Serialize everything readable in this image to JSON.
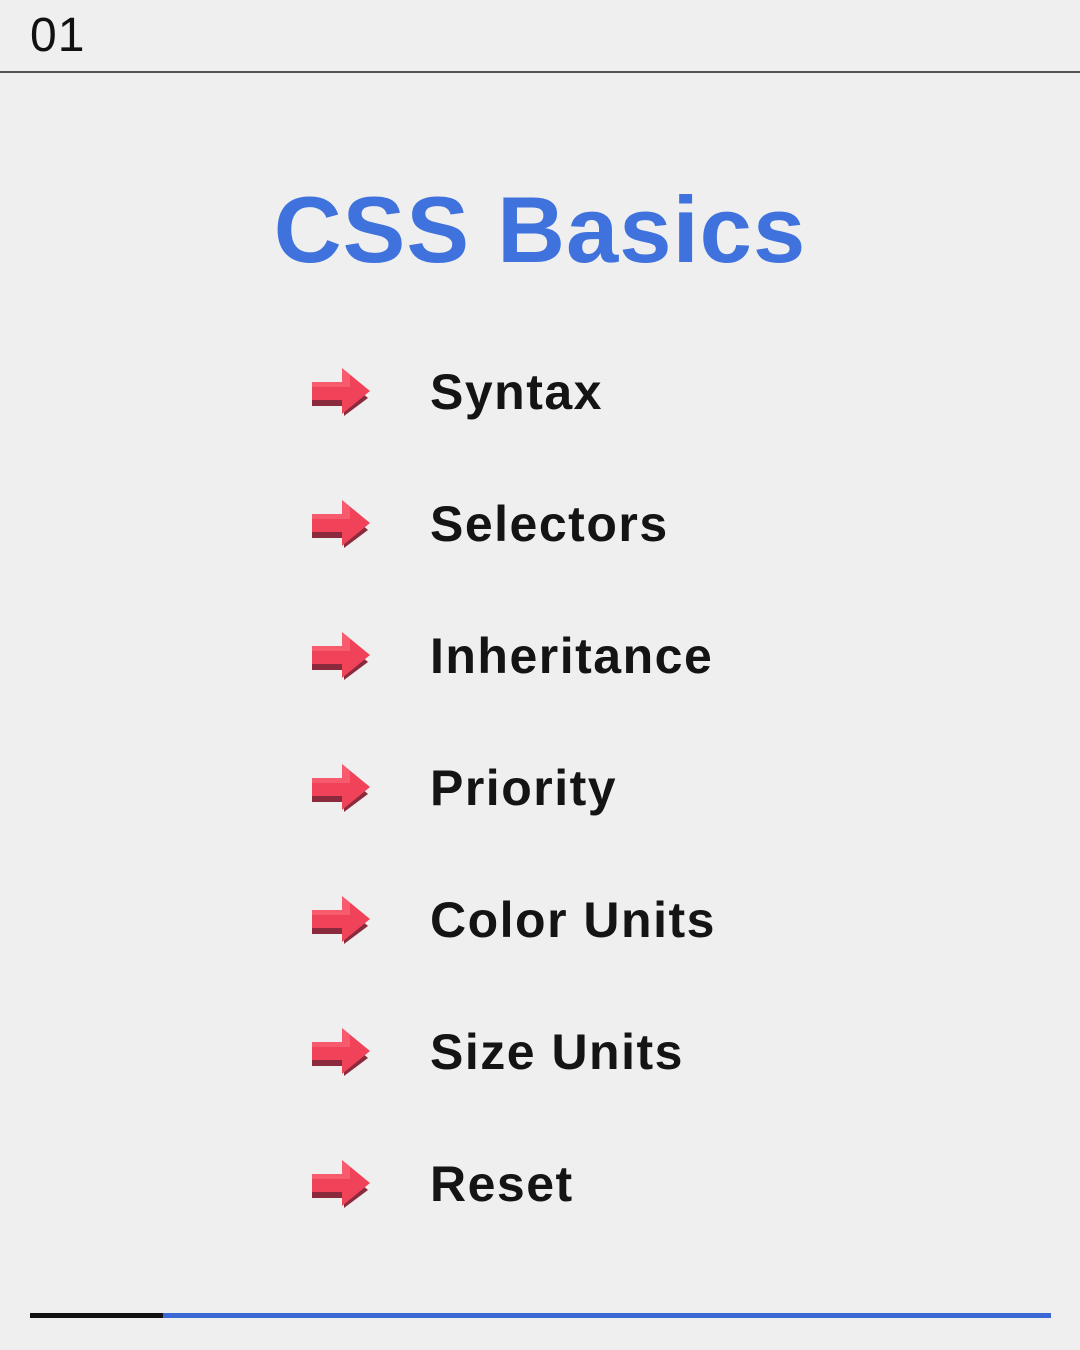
{
  "page_number": "01",
  "title": "CSS Basics",
  "colors": {
    "title": "#3f72dc",
    "arrow": "#f0435a",
    "arrow_shadow": "#8a2a3c",
    "progress_done": "#111111",
    "progress_remaining": "#3a68d4"
  },
  "topics": [
    {
      "label": "Syntax",
      "icon": "right-arrow-icon"
    },
    {
      "label": "Selectors",
      "icon": "right-arrow-icon"
    },
    {
      "label": "Inheritance",
      "icon": "right-arrow-icon"
    },
    {
      "label": "Priority",
      "icon": "right-arrow-icon"
    },
    {
      "label": "Color Units",
      "icon": "right-arrow-icon"
    },
    {
      "label": "Size Units",
      "icon": "right-arrow-icon"
    },
    {
      "label": "Reset",
      "icon": "right-arrow-icon"
    }
  ],
  "progress": 0.13
}
